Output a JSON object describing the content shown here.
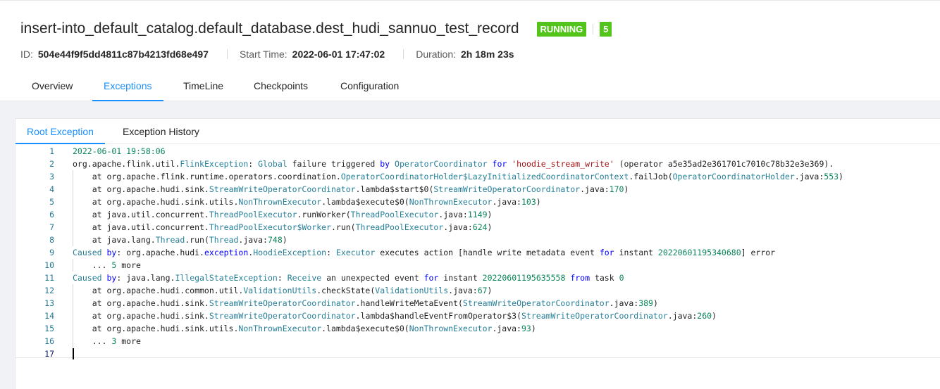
{
  "job": {
    "title": "insert-into_default_catalog.default_database.dest_hudi_sannuo_test_record",
    "status": "RUNNING",
    "task_count": "5",
    "id_label": "ID:",
    "id_value": "504e44f9f5dd4811c87b4213fd68e497",
    "start_label": "Start Time:",
    "start_value": "2022-06-01 17:47:02",
    "duration_label": "Duration:",
    "duration_value": "2h 18m 23s"
  },
  "tabs": [
    {
      "label": "Overview"
    },
    {
      "label": "Exceptions"
    },
    {
      "label": "TimeLine"
    },
    {
      "label": "Checkpoints"
    },
    {
      "label": "Configuration"
    }
  ],
  "subtabs": [
    {
      "label": "Root Exception"
    },
    {
      "label": "Exception History"
    }
  ],
  "colors": {
    "accent": "#1890ff",
    "status_green": "#52c41a",
    "token_number": "#098658",
    "token_class": "#267f99",
    "token_keyword": "#0000ff",
    "token_string": "#a31515",
    "line_number": "#237893"
  },
  "editor": {
    "lines": [
      {
        "n": "1",
        "indent": 0,
        "tokens": [
          [
            "num",
            "2022-06-01 19:58:06"
          ]
        ]
      },
      {
        "n": "2",
        "indent": 0,
        "tokens": [
          [
            "",
            "org.apache.flink.util."
          ],
          [
            "cls",
            "FlinkException"
          ],
          [
            "",
            ": "
          ],
          [
            "cls",
            "Global"
          ],
          [
            "",
            " failure triggered "
          ],
          [
            "kw",
            "by"
          ],
          [
            "",
            " "
          ],
          [
            "cls",
            "OperatorCoordinator"
          ],
          [
            "",
            " "
          ],
          [
            "kw",
            "for"
          ],
          [
            "",
            " "
          ],
          [
            "str",
            "'hoodie_stream_write'"
          ],
          [
            "",
            " (operator a5e35ad2e361701c7010c78b32e3e369).  "
          ]
        ]
      },
      {
        "n": "3",
        "indent": 1,
        "tokens": [
          [
            "",
            "    at org.apache.flink.runtime.operators.coordination."
          ],
          [
            "cls",
            "OperatorCoordinatorHolder$LazyInitializedCoordinatorContext"
          ],
          [
            "",
            ".failJob("
          ],
          [
            "cls",
            "OperatorCoordinatorHolder"
          ],
          [
            "",
            ".java:"
          ],
          [
            "num",
            "553"
          ],
          [
            "",
            ")"
          ]
        ]
      },
      {
        "n": "4",
        "indent": 1,
        "tokens": [
          [
            "",
            "    at org.apache.hudi.sink."
          ],
          [
            "cls",
            "StreamWriteOperatorCoordinator"
          ],
          [
            "",
            ".lambda$start$0("
          ],
          [
            "cls",
            "StreamWriteOperatorCoordinator"
          ],
          [
            "",
            ".java:"
          ],
          [
            "num",
            "170"
          ],
          [
            "",
            ")"
          ]
        ]
      },
      {
        "n": "5",
        "indent": 1,
        "tokens": [
          [
            "",
            "    at org.apache.hudi.sink.utils."
          ],
          [
            "cls",
            "NonThrownExecutor"
          ],
          [
            "",
            ".lambda$execute$0("
          ],
          [
            "cls",
            "NonThrownExecutor"
          ],
          [
            "",
            ".java:"
          ],
          [
            "num",
            "103"
          ],
          [
            "",
            ")"
          ]
        ]
      },
      {
        "n": "6",
        "indent": 1,
        "tokens": [
          [
            "",
            "    at java.util.concurrent."
          ],
          [
            "cls",
            "ThreadPoolExecutor"
          ],
          [
            "",
            ".runWorker("
          ],
          [
            "cls",
            "ThreadPoolExecutor"
          ],
          [
            "",
            ".java:"
          ],
          [
            "num",
            "1149"
          ],
          [
            "",
            ")"
          ]
        ]
      },
      {
        "n": "7",
        "indent": 1,
        "tokens": [
          [
            "",
            "    at java.util.concurrent."
          ],
          [
            "cls",
            "ThreadPoolExecutor$Worker"
          ],
          [
            "",
            ".run("
          ],
          [
            "cls",
            "ThreadPoolExecutor"
          ],
          [
            "",
            ".java:"
          ],
          [
            "num",
            "624"
          ],
          [
            "",
            ")"
          ]
        ]
      },
      {
        "n": "8",
        "indent": 1,
        "tokens": [
          [
            "",
            "    at java.lang."
          ],
          [
            "cls",
            "Thread"
          ],
          [
            "",
            ".run("
          ],
          [
            "cls",
            "Thread"
          ],
          [
            "",
            ".java:"
          ],
          [
            "num",
            "748"
          ],
          [
            "",
            ")"
          ]
        ]
      },
      {
        "n": "9",
        "indent": 0,
        "tokens": [
          [
            "cls",
            "Caused"
          ],
          [
            "",
            " "
          ],
          [
            "kw",
            "by"
          ],
          [
            "",
            ": org.apache.hudi."
          ],
          [
            "kw",
            "exception"
          ],
          [
            "",
            "."
          ],
          [
            "cls",
            "HoodieException"
          ],
          [
            "",
            ": "
          ],
          [
            "cls",
            "Executor"
          ],
          [
            "",
            " executes action [handle write metadata event "
          ],
          [
            "kw",
            "for"
          ],
          [
            "",
            " instant "
          ],
          [
            "num",
            "20220601195340680"
          ],
          [
            "",
            "] error"
          ]
        ]
      },
      {
        "n": "10",
        "indent": 1,
        "tokens": [
          [
            "",
            "    ... "
          ],
          [
            "num",
            "5"
          ],
          [
            "",
            " more"
          ]
        ]
      },
      {
        "n": "11",
        "indent": 0,
        "tokens": [
          [
            "cls",
            "Caused"
          ],
          [
            "",
            " "
          ],
          [
            "kw",
            "by"
          ],
          [
            "",
            ": java.lang."
          ],
          [
            "cls",
            "IllegalStateException"
          ],
          [
            "",
            ": "
          ],
          [
            "cls",
            "Receive"
          ],
          [
            "",
            " an unexpected event "
          ],
          [
            "kw",
            "for"
          ],
          [
            "",
            " instant "
          ],
          [
            "num",
            "20220601195635558"
          ],
          [
            "",
            " "
          ],
          [
            "kw",
            "from"
          ],
          [
            "",
            " task "
          ],
          [
            "num",
            "0"
          ]
        ]
      },
      {
        "n": "12",
        "indent": 1,
        "tokens": [
          [
            "",
            "    at org.apache.hudi.common.util."
          ],
          [
            "cls",
            "ValidationUtils"
          ],
          [
            "",
            ".checkState("
          ],
          [
            "cls",
            "ValidationUtils"
          ],
          [
            "",
            ".java:"
          ],
          [
            "num",
            "67"
          ],
          [
            "",
            ")"
          ]
        ]
      },
      {
        "n": "13",
        "indent": 1,
        "tokens": [
          [
            "",
            "    at org.apache.hudi.sink."
          ],
          [
            "cls",
            "StreamWriteOperatorCoordinator"
          ],
          [
            "",
            ".handleWriteMetaEvent("
          ],
          [
            "cls",
            "StreamWriteOperatorCoordinator"
          ],
          [
            "",
            ".java:"
          ],
          [
            "num",
            "389"
          ],
          [
            "",
            ")"
          ]
        ]
      },
      {
        "n": "14",
        "indent": 1,
        "tokens": [
          [
            "",
            "    at org.apache.hudi.sink."
          ],
          [
            "cls",
            "StreamWriteOperatorCoordinator"
          ],
          [
            "",
            ".lambda$handleEventFromOperator$3("
          ],
          [
            "cls",
            "StreamWriteOperatorCoordinator"
          ],
          [
            "",
            ".java:"
          ],
          [
            "num",
            "260"
          ],
          [
            "",
            ")"
          ]
        ]
      },
      {
        "n": "15",
        "indent": 1,
        "tokens": [
          [
            "",
            "    at org.apache.hudi.sink.utils."
          ],
          [
            "cls",
            "NonThrownExecutor"
          ],
          [
            "",
            ".lambda$execute$0("
          ],
          [
            "cls",
            "NonThrownExecutor"
          ],
          [
            "",
            ".java:"
          ],
          [
            "num",
            "93"
          ],
          [
            "",
            ")"
          ]
        ]
      },
      {
        "n": "16",
        "indent": 1,
        "tokens": [
          [
            "",
            "    ... "
          ],
          [
            "num",
            "3"
          ],
          [
            "",
            " more"
          ]
        ]
      },
      {
        "n": "17",
        "indent": 0,
        "tokens": []
      }
    ]
  }
}
